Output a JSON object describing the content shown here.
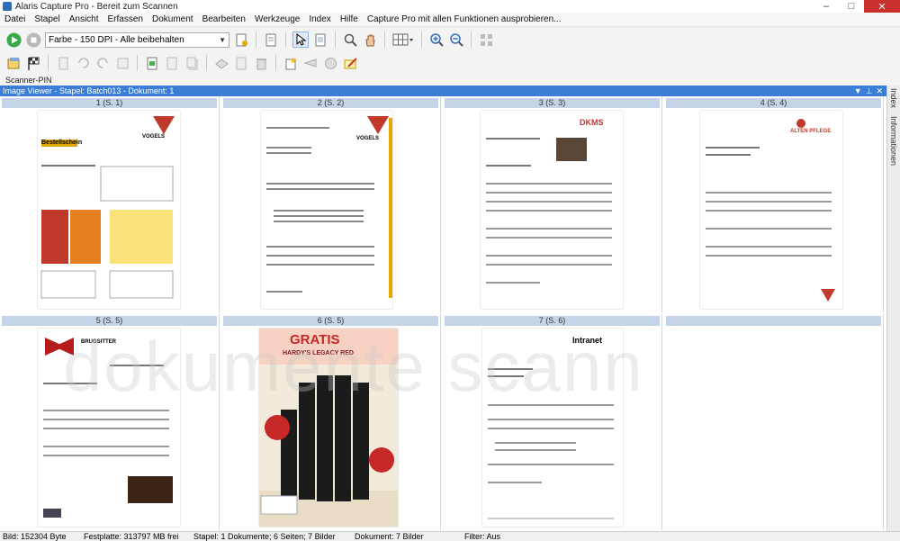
{
  "window": {
    "title": "Alaris Capture Pro - Bereit zum Scannen"
  },
  "menu": [
    "Datei",
    "Stapel",
    "Ansicht",
    "Erfassen",
    "Dokument",
    "Bearbeiten",
    "Werkzeuge",
    "Index",
    "Hilfe",
    "Capture Pro mit allen Funktionen ausprobieren..."
  ],
  "toolbar": {
    "profile_value": "Farbe - 150 DPI - Alle beibehalten"
  },
  "scanner_label": "Scanner-PIN",
  "viewer": {
    "title": "Image Viewer - Stapel: Batch013 - Dokument: 1"
  },
  "right_tabs": {
    "index": "Index",
    "info": "Informationen"
  },
  "thumbnails": [
    {
      "caption": "1 (S. 1)",
      "logo": "VOGELS",
      "headline": "Bestellschein"
    },
    {
      "caption": "2 (S. 2)",
      "logo": "VOGELS",
      "headline": ""
    },
    {
      "caption": "3 (S. 3)",
      "logo": "DKMS",
      "headline": ""
    },
    {
      "caption": "4 (S. 4)",
      "logo": "ALTEN PFLEGE",
      "headline": ""
    },
    {
      "caption": "5 (S. 5)",
      "logo": "BRUGSITTER",
      "headline": ""
    },
    {
      "caption": "6 (S. 5)",
      "logo": "GRATIS",
      "headline": "HARDY'S LEGACY RED"
    },
    {
      "caption": "7 (S. 6)",
      "logo": "Intranet",
      "headline": ""
    },
    {
      "caption": "",
      "logo": "",
      "headline": ""
    }
  ],
  "watermark": "dokumente scann",
  "status": {
    "bild": "Bild: 152304 Byte",
    "festplatte": "Festplatte: 313797 MB frei",
    "stapel": "Stapel: 1 Dokumente; 6 Seiten; 7 Bilder",
    "dokument": "Dokument: 7 Bilder",
    "filter": "Filter: Aus"
  },
  "colors": {
    "accent": "#3a7fd5",
    "caption_bg": "#c5d4e7",
    "close": "#c9302c"
  }
}
